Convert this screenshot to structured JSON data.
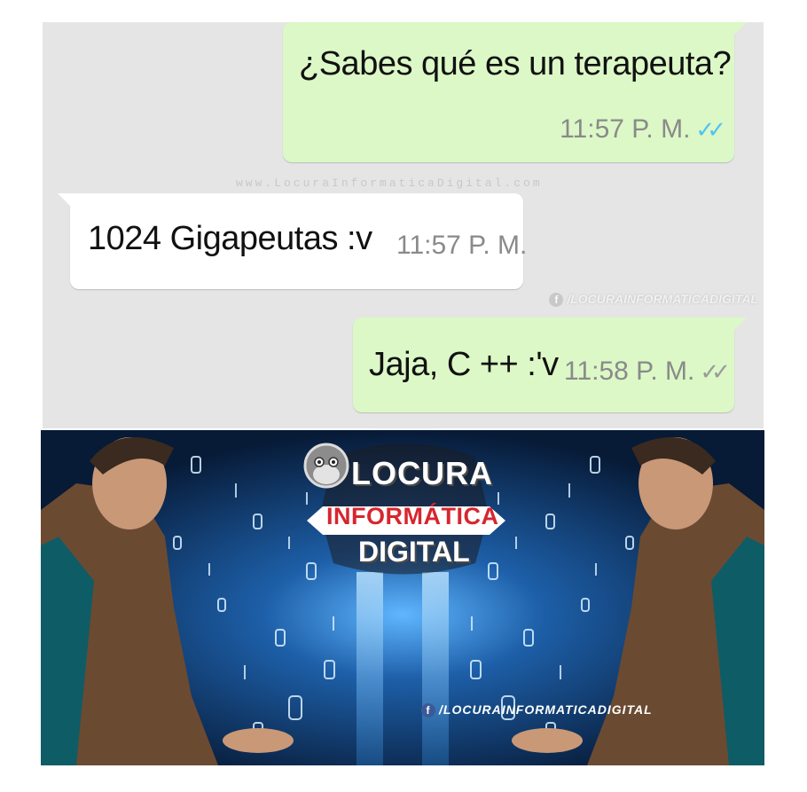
{
  "chat": {
    "messages": [
      {
        "text": "¿Sabes qué es un terapeuta?",
        "time": "11:57 P. M.",
        "status": "✓✓"
      },
      {
        "text": "1024 Gigapeutas :v",
        "time": "11:57 P. M."
      },
      {
        "text": "Jaja, C ++ :'v",
        "time": "11:58 P. M.",
        "status": "✓✓"
      }
    ],
    "watermark_url": "www.LocuraInformaticaDigital.com",
    "watermark_fb": "/LOCURAINFORMATICADIGITAL"
  },
  "banner": {
    "logo_line1": "LOCURA",
    "logo_line2": "INFORMÁTICA",
    "logo_line3": "DIGITAL",
    "fb_handle": "/LOCURAINFORMATICADIGITAL"
  },
  "colors": {
    "chat_background": "#e5e5e5",
    "outgoing_bubble": "#dcf8c6",
    "incoming_bubble": "#ffffff",
    "read_tick": "#4fc3f7",
    "delivered_tick": "#9a9a9a",
    "banner_background": "#0b2345",
    "logo_red": "#d7262e"
  },
  "icons": {
    "tick": "double-check-icon",
    "facebook": "facebook-icon",
    "mascot": "monkey-mascot-icon"
  }
}
